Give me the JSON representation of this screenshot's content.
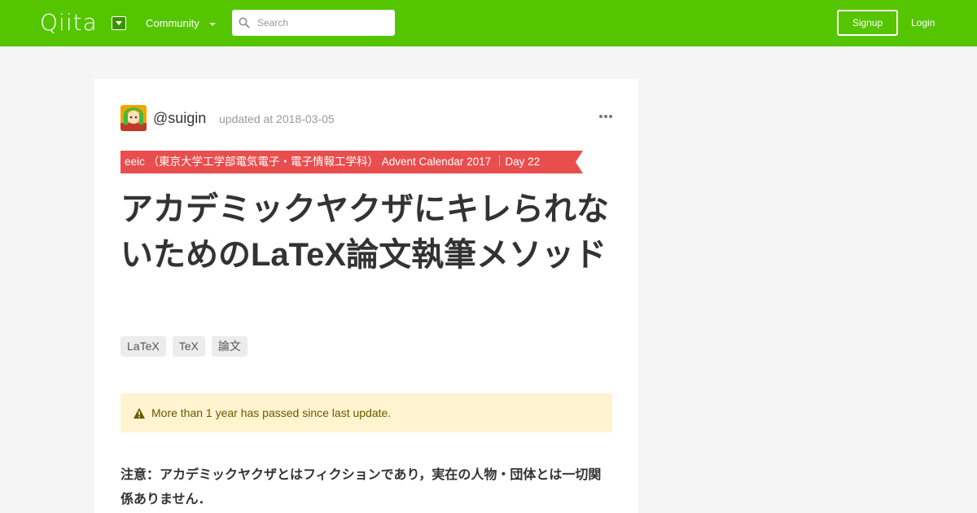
{
  "header": {
    "logo": "Qiita",
    "community_label": "Community",
    "search_placeholder": "Search",
    "signup_label": "Signup",
    "login_label": "Login",
    "icons": [
      "caret-down-icon",
      "search-icon"
    ]
  },
  "article": {
    "author": "@suigin",
    "updated": "updated at 2018-03-05",
    "advent_ribbon": "eeic （東京大学工学部電気電子・電子情報工学科） Advent Calendar 2017 ｜Day 22",
    "title": "アカデミックヤクザにキレられないためのLaTeX論文執筆メソッド",
    "tags": [
      "LaTeX",
      "TeX",
      "論文"
    ],
    "notice": "More than 1 year has passed since last update.",
    "body": "注意：アカデミックヤクザとはフィクションであり，実在の人物・団体とは一切関係ありません．"
  },
  "colors": {
    "brand": "#55c500",
    "ribbon": "#e94e4e",
    "notice_bg": "#fff4cf",
    "notice_text": "#6b5800"
  }
}
